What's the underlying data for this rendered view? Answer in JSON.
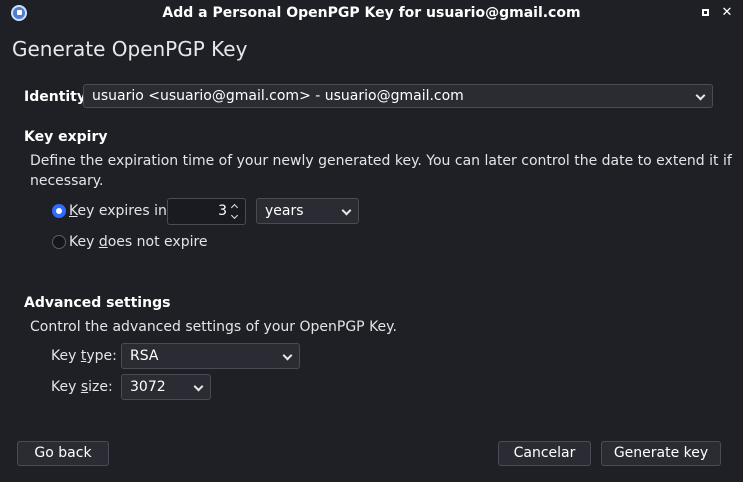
{
  "window": {
    "title": "Add a Personal OpenPGP Key for usuario@gmail.com",
    "maximize_icon": "maximize-icon",
    "close_glyph": "✕"
  },
  "heading": "Generate OpenPGP Key",
  "identity": {
    "label": "Identity",
    "selected": "usuario <usuario@gmail.com> - usuario@gmail.com"
  },
  "key_expiry": {
    "title": "Key expiry",
    "description_line1": "Define the expiration time of your newly generated key. You can later control the date to extend it if",
    "description_line2": "necessary.",
    "expires_in": {
      "label_underlined": "K",
      "label_rest": "ey expires in",
      "checked": true,
      "value": "3",
      "unit": "years"
    },
    "no_expire": {
      "label_prefix": "Key ",
      "label_underlined": "d",
      "label_rest": "oes not expire",
      "checked": false
    }
  },
  "advanced": {
    "title": "Advanced settings",
    "description": "Control the advanced settings of your OpenPGP Key.",
    "key_type": {
      "label_prefix": "Key ",
      "label_underlined": "t",
      "label_rest": "ype:",
      "value": "RSA"
    },
    "key_size": {
      "label_prefix": "Key ",
      "label_underlined": "s",
      "label_rest": "ize:",
      "value": "3072"
    }
  },
  "buttons": {
    "go_back": "Go back",
    "cancel": "Cancelar",
    "generate": "Generate key"
  },
  "colors": {
    "accent": "#2f6bff",
    "background": "#1f2026"
  }
}
